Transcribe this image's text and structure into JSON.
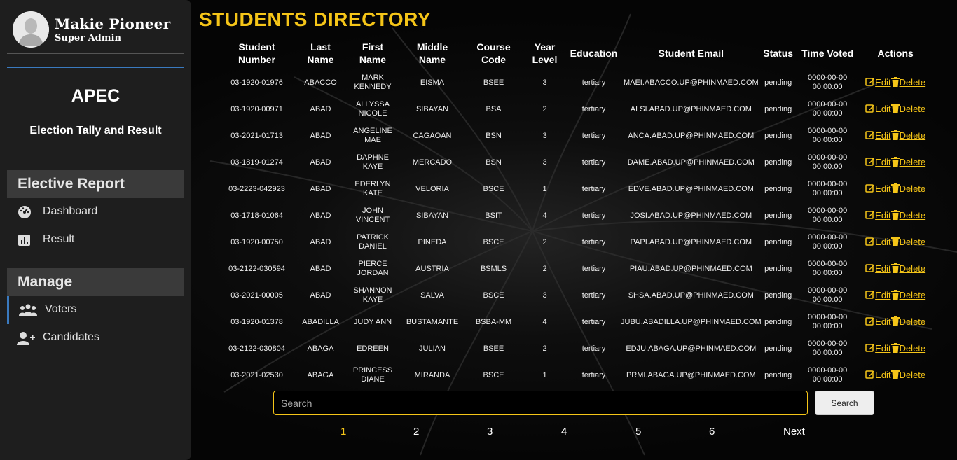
{
  "sidebar": {
    "profile": {
      "name": "Makie Pioneer",
      "role": "Super Admin"
    },
    "brand": {
      "title": "APEC",
      "subtitle": "Election Tally and Result"
    },
    "sections": [
      {
        "heading": "Elective Report",
        "items": [
          {
            "label": "Dashboard",
            "icon": "dashboard-icon"
          },
          {
            "label": "Result",
            "icon": "chart-icon"
          }
        ]
      },
      {
        "heading": "Manage",
        "items": [
          {
            "label": "Voters",
            "icon": "users-icon"
          },
          {
            "label": "Candidates",
            "icon": "add-user-icon"
          }
        ]
      }
    ]
  },
  "main": {
    "title": "STUDENTS DIRECTORY",
    "columns": [
      "Student Number",
      "Last Name",
      "First Name",
      "Middle Name",
      "Course Code",
      "Year Level",
      "Education",
      "Student Email",
      "Status",
      "Time Voted",
      "Actions"
    ],
    "actions": {
      "edit": "Edit",
      "delete": "Delete"
    },
    "rows": [
      {
        "number": "03-1920-01976",
        "last": "ABACCO",
        "first": "MARK KENNEDY",
        "middle": "EISMA",
        "course": "BSEE",
        "year": "3",
        "education": "tertiary",
        "email": "MAEI.ABACCO.UP@PHINMAED.COM",
        "status": "pending",
        "time": "0000-00-00 00:00:00"
      },
      {
        "number": "03-1920-00971",
        "last": "ABAD",
        "first": "ALLYSSA NICOLE",
        "middle": "SIBAYAN",
        "course": "BSA",
        "year": "2",
        "education": "tertiary",
        "email": "ALSI.ABAD.UP@PHINMAED.COM",
        "status": "pending",
        "time": "0000-00-00 00:00:00"
      },
      {
        "number": "03-2021-01713",
        "last": "ABAD",
        "first": "ANGELINE MAE",
        "middle": "CAGAOAN",
        "course": "BSN",
        "year": "3",
        "education": "tertiary",
        "email": "ANCA.ABAD.UP@PHINMAED.COM",
        "status": "pending",
        "time": "0000-00-00 00:00:00"
      },
      {
        "number": "03-1819-01274",
        "last": "ABAD",
        "first": "DAPHNE KAYE",
        "middle": "MERCADO",
        "course": "BSN",
        "year": "3",
        "education": "tertiary",
        "email": "DAME.ABAD.UP@PHINMAED.COM",
        "status": "pending",
        "time": "0000-00-00 00:00:00"
      },
      {
        "number": "03-2223-042923",
        "last": "ABAD",
        "first": "EDERLYN KATE",
        "middle": "VELORIA",
        "course": "BSCE",
        "year": "1",
        "education": "tertiary",
        "email": "EDVE.ABAD.UP@PHINMAED.COM",
        "status": "pending",
        "time": "0000-00-00 00:00:00"
      },
      {
        "number": "03-1718-01064",
        "last": "ABAD",
        "first": "JOHN VINCENT",
        "middle": "SIBAYAN",
        "course": "BSIT",
        "year": "4",
        "education": "tertiary",
        "email": "JOSI.ABAD.UP@PHINMAED.COM",
        "status": "pending",
        "time": "0000-00-00 00:00:00"
      },
      {
        "number": "03-1920-00750",
        "last": "ABAD",
        "first": "PATRICK DANIEL",
        "middle": "PINEDA",
        "course": "BSCE",
        "year": "2",
        "education": "tertiary",
        "email": "PAPI.ABAD.UP@PHINMAED.COM",
        "status": "pending",
        "time": "0000-00-00 00:00:00"
      },
      {
        "number": "03-2122-030594",
        "last": "ABAD",
        "first": "PIERCE JORDAN",
        "middle": "AUSTRIA",
        "course": "BSMLS",
        "year": "2",
        "education": "tertiary",
        "email": "PIAU.ABAD.UP@PHINMAED.COM",
        "status": "pending",
        "time": "0000-00-00 00:00:00"
      },
      {
        "number": "03-2021-00005",
        "last": "ABAD",
        "first": "SHANNON KAYE",
        "middle": "SALVA",
        "course": "BSCE",
        "year": "3",
        "education": "tertiary",
        "email": "SHSA.ABAD.UP@PHINMAED.COM",
        "status": "pending",
        "time": "0000-00-00 00:00:00"
      },
      {
        "number": "03-1920-01378",
        "last": "ABADILLA",
        "first": "JUDY ANN",
        "middle": "BUSTAMANTE",
        "course": "BSBA-MM",
        "year": "4",
        "education": "tertiary",
        "email": "JUBU.ABADILLA.UP@PHINMAED.COM",
        "status": "pending",
        "time": "0000-00-00 00:00:00"
      },
      {
        "number": "03-2122-030804",
        "last": "ABAGA",
        "first": "EDREEN",
        "middle": "JULIAN",
        "course": "BSEE",
        "year": "2",
        "education": "tertiary",
        "email": "EDJU.ABAGA.UP@PHINMAED.COM",
        "status": "pending",
        "time": "0000-00-00 00:00:00"
      },
      {
        "number": "03-2021-02530",
        "last": "ABAGA",
        "first": "PRINCESS DIANE",
        "middle": "MIRANDA",
        "course": "BSCE",
        "year": "1",
        "education": "tertiary",
        "email": "PRMI.ABAGA.UP@PHINMAED.COM",
        "status": "pending",
        "time": "0000-00-00 00:00:00"
      }
    ],
    "search": {
      "placeholder": "Search",
      "value": "",
      "button": "Search"
    },
    "pagination": {
      "pages": [
        "1",
        "2",
        "3",
        "4",
        "5",
        "6"
      ],
      "current": "1",
      "next": "Next"
    }
  },
  "colors": {
    "accent": "#f5c518",
    "sidebar": "#1e1e1e",
    "section": "#3a3a3a",
    "divider": "#3a7abf"
  }
}
